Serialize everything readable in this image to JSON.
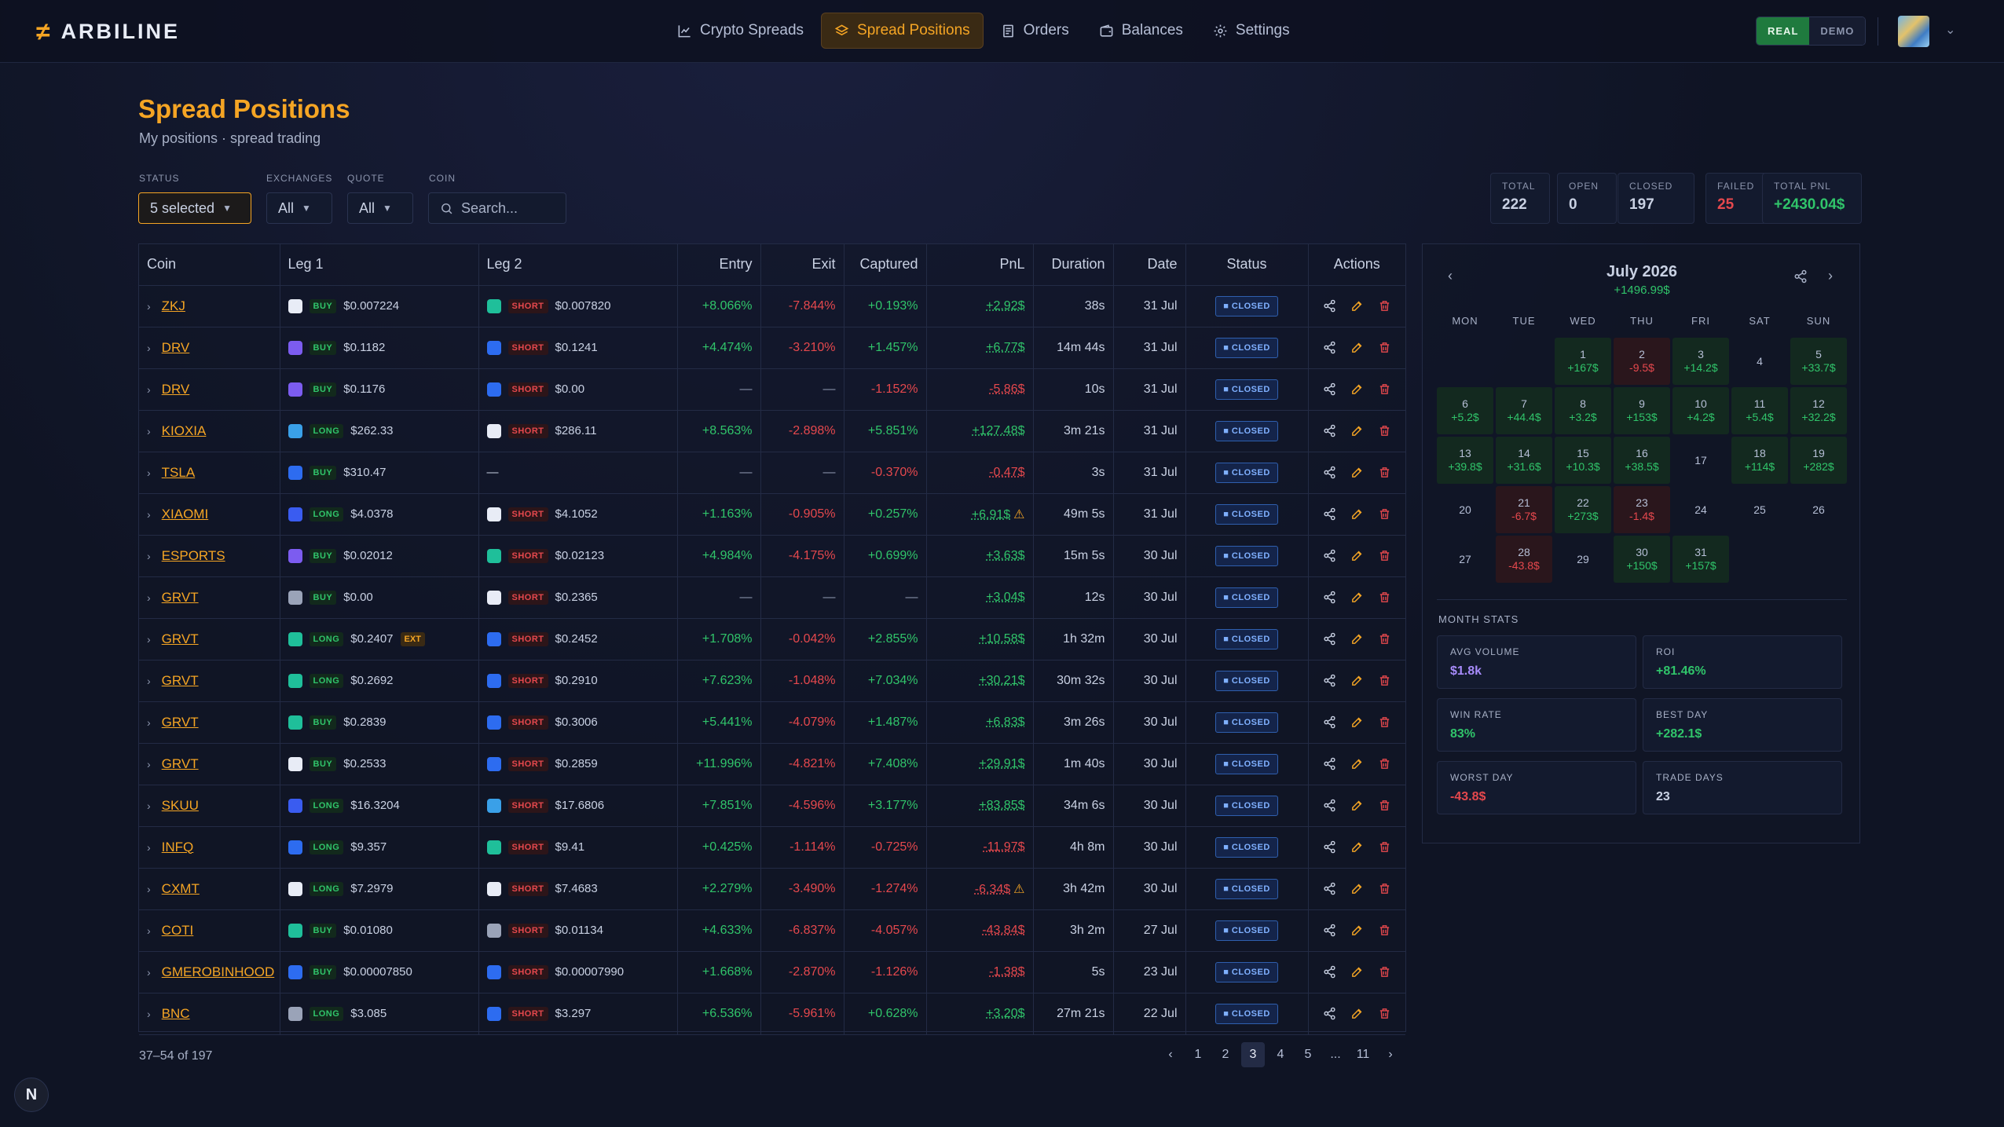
{
  "app": {
    "name": "ARBILINE",
    "logo_glyph": "≠"
  },
  "nav": [
    {
      "label": "Crypto Spreads",
      "icon": "chart-line-icon",
      "active": false
    },
    {
      "label": "Spread Positions",
      "icon": "layers-icon",
      "active": true
    },
    {
      "label": "Orders",
      "icon": "receipt-icon",
      "active": false
    },
    {
      "label": "Balances",
      "icon": "wallet-icon",
      "active": false
    },
    {
      "label": "Settings",
      "icon": "gear-icon",
      "active": false
    }
  ],
  "mode": {
    "real": "REAL",
    "demo": "DEMO",
    "selected": "REAL"
  },
  "page": {
    "title": "Spread Positions",
    "subtitle": "My positions · spread trading"
  },
  "filters": {
    "status": {
      "label": "STATUS",
      "value": "5 selected"
    },
    "exchanges": {
      "label": "EXCHANGES",
      "value": "All"
    },
    "quote": {
      "label": "QUOTE",
      "value": "All"
    },
    "coin": {
      "label": "COIN",
      "placeholder": "Search..."
    }
  },
  "stats": [
    {
      "label": "TOTAL",
      "value": "222",
      "tone": "plain"
    },
    {
      "label": "OPEN",
      "value": "0",
      "tone": "plain"
    },
    {
      "label": "CLOSED",
      "value": "197",
      "tone": "plain"
    },
    {
      "label": "FAILED",
      "value": "25",
      "tone": "red"
    },
    {
      "label": "TOTAL PNL",
      "value": "+2430.04$",
      "tone": "green"
    }
  ],
  "table": {
    "headers": [
      "Coin",
      "Leg 1",
      "Leg 2",
      "Entry",
      "Exit",
      "Captured",
      "PnL",
      "Duration",
      "Date",
      "Status",
      "Actions"
    ],
    "rows": [
      {
        "coin": "ZKJ",
        "l1_ex": "#e8ecf6",
        "l1_side": "BUY",
        "l1_price": "$0.007224",
        "l2_ex": "#1fbf9a",
        "l2_side": "SHORT",
        "l2_price": "$0.007820",
        "entry": "+8.066%",
        "exit": "-7.844%",
        "captured": "+0.193%",
        "pnl": "+2.92$",
        "warn": false,
        "duration": "38s",
        "date": "31 Jul",
        "status": "CLOSED"
      },
      {
        "coin": "DRV",
        "l1_ex": "#7c5cf0",
        "l1_side": "BUY",
        "l1_price": "$0.1182",
        "l2_ex": "#2d6cf0",
        "l2_side": "SHORT",
        "l2_price": "$0.1241",
        "entry": "+4.474%",
        "exit": "-3.210%",
        "captured": "+1.457%",
        "pnl": "+6.77$",
        "warn": false,
        "duration": "14m 44s",
        "date": "31 Jul",
        "status": "CLOSED"
      },
      {
        "coin": "DRV",
        "l1_ex": "#7c5cf0",
        "l1_side": "BUY",
        "l1_price": "$0.1176",
        "l2_ex": "#2d6cf0",
        "l2_side": "SHORT",
        "l2_price": "$0.00",
        "entry": "—",
        "exit": "—",
        "captured": "-1.152%",
        "pnl": "-5.86$",
        "warn": false,
        "duration": "10s",
        "date": "31 Jul",
        "status": "CLOSED"
      },
      {
        "coin": "KIOXIA",
        "l1_ex": "#3aa0e8",
        "l1_side": "LONG",
        "l1_price": "$262.33",
        "l2_ex": "#e8ecf6",
        "l2_side": "SHORT",
        "l2_price": "$286.11",
        "entry": "+8.563%",
        "exit": "-2.898%",
        "captured": "+5.851%",
        "pnl": "+127.48$",
        "warn": false,
        "duration": "3m 21s",
        "date": "31 Jul",
        "status": "CLOSED"
      },
      {
        "coin": "TSLA",
        "l1_ex": "#2d6cf0",
        "l1_side": "BUY",
        "l1_price": "$310.47",
        "l2_ex": "",
        "l2_side": "",
        "l2_price": "—",
        "entry": "—",
        "exit": "—",
        "captured": "-0.370%",
        "pnl": "-0.47$",
        "warn": false,
        "duration": "3s",
        "date": "31 Jul",
        "status": "CLOSED"
      },
      {
        "coin": "XIAOMI",
        "l1_ex": "#3a5cf0",
        "l1_side": "LONG",
        "l1_price": "$4.0378",
        "l2_ex": "#e8ecf6",
        "l2_side": "SHORT",
        "l2_price": "$4.1052",
        "entry": "+1.163%",
        "exit": "-0.905%",
        "captured": "+0.257%",
        "pnl": "+6.91$",
        "warn": true,
        "duration": "49m 5s",
        "date": "31 Jul",
        "status": "CLOSED"
      },
      {
        "coin": "ESPORTS",
        "l1_ex": "#7c5cf0",
        "l1_side": "BUY",
        "l1_price": "$0.02012",
        "l2_ex": "#1fbf9a",
        "l2_side": "SHORT",
        "l2_price": "$0.02123",
        "entry": "+4.984%",
        "exit": "-4.175%",
        "captured": "+0.699%",
        "pnl": "+3.63$",
        "warn": false,
        "duration": "15m 5s",
        "date": "30 Jul",
        "status": "CLOSED"
      },
      {
        "coin": "GRVT",
        "l1_ex": "#9aa3b8",
        "l1_side": "BUY",
        "l1_price": "$0.00",
        "l2_ex": "#e8ecf6",
        "l2_side": "SHORT",
        "l2_price": "$0.2365",
        "entry": "—",
        "exit": "—",
        "captured": "—",
        "pnl": "+3.04$",
        "warn": false,
        "duration": "12s",
        "date": "30 Jul",
        "status": "CLOSED"
      },
      {
        "coin": "GRVT",
        "l1_ex": "#1fbf9a",
        "l1_side": "LONG",
        "l1_price": "$0.2407",
        "ext": "EXT",
        "l2_ex": "#2d6cf0",
        "l2_side": "SHORT",
        "l2_price": "$0.2452",
        "entry": "+1.708%",
        "exit": "-0.042%",
        "captured": "+2.855%",
        "pnl": "+10.58$",
        "warn": false,
        "duration": "1h 32m",
        "date": "30 Jul",
        "status": "CLOSED"
      },
      {
        "coin": "GRVT",
        "l1_ex": "#1fbf9a",
        "l1_side": "LONG",
        "l1_price": "$0.2692",
        "l2_ex": "#2d6cf0",
        "l2_side": "SHORT",
        "l2_price": "$0.2910",
        "entry": "+7.623%",
        "exit": "-1.048%",
        "captured": "+7.034%",
        "pnl": "+30.21$",
        "warn": false,
        "duration": "30m 32s",
        "date": "30 Jul",
        "status": "CLOSED"
      },
      {
        "coin": "GRVT",
        "l1_ex": "#1fbf9a",
        "l1_side": "BUY",
        "l1_price": "$0.2839",
        "l2_ex": "#2d6cf0",
        "l2_side": "SHORT",
        "l2_price": "$0.3006",
        "entry": "+5.441%",
        "exit": "-4.079%",
        "captured": "+1.487%",
        "pnl": "+6.83$",
        "warn": false,
        "duration": "3m 26s",
        "date": "30 Jul",
        "status": "CLOSED"
      },
      {
        "coin": "GRVT",
        "l1_ex": "#e8ecf6",
        "l1_side": "BUY",
        "l1_price": "$0.2533",
        "l2_ex": "#2d6cf0",
        "l2_side": "SHORT",
        "l2_price": "$0.2859",
        "entry": "+11.996%",
        "exit": "-4.821%",
        "captured": "+7.408%",
        "pnl": "+29.91$",
        "warn": false,
        "duration": "1m 40s",
        "date": "30 Jul",
        "status": "CLOSED"
      },
      {
        "coin": "SKUU",
        "l1_ex": "#3a5cf0",
        "l1_side": "LONG",
        "l1_price": "$16.3204",
        "l2_ex": "#3aa0e8",
        "l2_side": "SHORT",
        "l2_price": "$17.6806",
        "entry": "+7.851%",
        "exit": "-4.596%",
        "captured": "+3.177%",
        "pnl": "+83.85$",
        "warn": false,
        "duration": "34m 6s",
        "date": "30 Jul",
        "status": "CLOSED"
      },
      {
        "coin": "INFQ",
        "l1_ex": "#2d6cf0",
        "l1_side": "LONG",
        "l1_price": "$9.357",
        "l2_ex": "#1fbf9a",
        "l2_side": "SHORT",
        "l2_price": "$9.41",
        "entry": "+0.425%",
        "exit": "-1.114%",
        "captured": "-0.725%",
        "pnl": "-11.97$",
        "warn": false,
        "duration": "4h 8m",
        "date": "30 Jul",
        "status": "CLOSED"
      },
      {
        "coin": "CXMT",
        "l1_ex": "#e8ecf6",
        "l1_side": "LONG",
        "l1_price": "$7.2979",
        "l2_ex": "#e8ecf6",
        "l2_side": "SHORT",
        "l2_price": "$7.4683",
        "entry": "+2.279%",
        "exit": "-3.490%",
        "captured": "-1.274%",
        "pnl": "-6.34$",
        "warn": true,
        "duration": "3h 42m",
        "date": "30 Jul",
        "status": "CLOSED"
      },
      {
        "coin": "COTI",
        "l1_ex": "#1fbf9a",
        "l1_side": "BUY",
        "l1_price": "$0.01080",
        "l2_ex": "#9aa3b8",
        "l2_side": "SHORT",
        "l2_price": "$0.01134",
        "entry": "+4.633%",
        "exit": "-6.837%",
        "captured": "-4.057%",
        "pnl": "-43.84$",
        "warn": false,
        "duration": "3h 2m",
        "date": "27 Jul",
        "status": "CLOSED"
      },
      {
        "coin": "GMEROBINHOOD",
        "l1_ex": "#2d6cf0",
        "l1_side": "BUY",
        "l1_price": "$0.00007850",
        "l2_ex": "#2d6cf0",
        "l2_side": "SHORT",
        "l2_price": "$0.00007990",
        "entry": "+1.668%",
        "exit": "-2.870%",
        "captured": "-1.126%",
        "pnl": "-1.38$",
        "warn": false,
        "duration": "5s",
        "date": "23 Jul",
        "status": "CLOSED"
      },
      {
        "coin": "BNC",
        "l1_ex": "#9aa3b8",
        "l1_side": "LONG",
        "l1_price": "$3.085",
        "l2_ex": "#2d6cf0",
        "l2_side": "SHORT",
        "l2_price": "$3.297",
        "entry": "+6.536%",
        "exit": "-5.961%",
        "captured": "+0.628%",
        "pnl": "+3.20$",
        "warn": false,
        "duration": "27m 21s",
        "date": "22 Jul",
        "status": "CLOSED"
      }
    ]
  },
  "pagination": {
    "range": "37–54 of 197",
    "pages": [
      "1",
      "2",
      "3",
      "4",
      "5",
      "...",
      "11"
    ],
    "current": "3"
  },
  "calendar": {
    "month": "July 2026",
    "total": "+1496.99$",
    "weekdays": [
      "MON",
      "TUE",
      "WED",
      "THU",
      "FRI",
      "SAT",
      "SUN"
    ],
    "leading_blanks": 2,
    "days": [
      {
        "d": "1",
        "amt": "+167$",
        "t": "win"
      },
      {
        "d": "2",
        "amt": "-9.5$",
        "t": "loss"
      },
      {
        "d": "3",
        "amt": "+14.2$",
        "t": "win"
      },
      {
        "d": "4",
        "amt": "",
        "t": ""
      },
      {
        "d": "5",
        "amt": "+33.7$",
        "t": "win"
      },
      {
        "d": "6",
        "amt": "+5.2$",
        "t": "win"
      },
      {
        "d": "7",
        "amt": "+44.4$",
        "t": "win"
      },
      {
        "d": "8",
        "amt": "+3.2$",
        "t": "win"
      },
      {
        "d": "9",
        "amt": "+153$",
        "t": "win"
      },
      {
        "d": "10",
        "amt": "+4.2$",
        "t": "win"
      },
      {
        "d": "11",
        "amt": "+5.4$",
        "t": "win"
      },
      {
        "d": "12",
        "amt": "+32.2$",
        "t": "win"
      },
      {
        "d": "13",
        "amt": "+39.8$",
        "t": "win"
      },
      {
        "d": "14",
        "amt": "+31.6$",
        "t": "win"
      },
      {
        "d": "15",
        "amt": "+10.3$",
        "t": "win"
      },
      {
        "d": "16",
        "amt": "+38.5$",
        "t": "win"
      },
      {
        "d": "17",
        "amt": "",
        "t": ""
      },
      {
        "d": "18",
        "amt": "+114$",
        "t": "win"
      },
      {
        "d": "19",
        "amt": "+282$",
        "t": "win"
      },
      {
        "d": "20",
        "amt": "",
        "t": ""
      },
      {
        "d": "21",
        "amt": "-6.7$",
        "t": "loss"
      },
      {
        "d": "22",
        "amt": "+273$",
        "t": "win"
      },
      {
        "d": "23",
        "amt": "-1.4$",
        "t": "loss"
      },
      {
        "d": "24",
        "amt": "",
        "t": ""
      },
      {
        "d": "25",
        "amt": "",
        "t": ""
      },
      {
        "d": "26",
        "amt": "",
        "t": ""
      },
      {
        "d": "27",
        "amt": "",
        "t": ""
      },
      {
        "d": "28",
        "amt": "-43.8$",
        "t": "loss"
      },
      {
        "d": "29",
        "amt": "",
        "t": ""
      },
      {
        "d": "30",
        "amt": "+150$",
        "t": "win"
      },
      {
        "d": "31",
        "amt": "+157$",
        "t": "win"
      }
    ],
    "month_stats_title": "MONTH STATS",
    "month_stats": [
      {
        "label": "AVG VOLUME",
        "value": "$1.8k",
        "tone": "purple"
      },
      {
        "label": "ROI",
        "value": "+81.46%",
        "tone": "green"
      },
      {
        "label": "WIN RATE",
        "value": "83%",
        "tone": "green"
      },
      {
        "label": "BEST DAY",
        "value": "+282.1$",
        "tone": "green"
      },
      {
        "label": "WORST DAY",
        "value": "-43.8$",
        "tone": "red"
      },
      {
        "label": "TRADE DAYS",
        "value": "23",
        "tone": "plain"
      }
    ]
  },
  "footer_badge": "N"
}
